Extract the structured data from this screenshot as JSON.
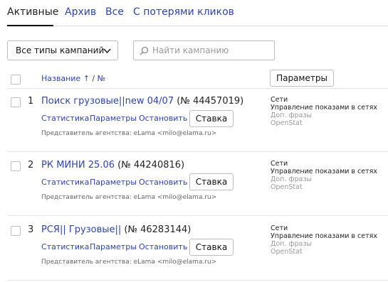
{
  "tabs": [
    "Активные",
    "Архив",
    "Все",
    "С потерями кликов"
  ],
  "filters": {
    "type_dropdown": "Все типы кампаний",
    "search_placeholder": "Найти кампанию"
  },
  "table_header": {
    "name": "Название",
    "sort_arrow": "↑",
    "sep": " / ",
    "num": "№"
  },
  "params_button": "Параметры",
  "actions": {
    "stats": "Статистика",
    "params": "Параметры",
    "stop": "Остановить",
    "bid": "Ставка"
  },
  "campaigns": [
    {
      "index": "1",
      "name": "Поиск грузовые||new 04/07",
      "id": " (№ 44457019)",
      "representative": "Представитель агентства:  eLama <milo@elama.ru>",
      "params": [
        "Сети",
        "Управление показами в сетях",
        "Доп. фразы",
        "OpenStat"
      ]
    },
    {
      "index": "2",
      "name": "РК МИНИ 25.06",
      "id": " (№ 44240816)",
      "representative": "Представитель агентства:  eLama <milo@elama.ru>",
      "params": [
        "Сети",
        "Управление показами в сетях",
        "Доп. фразы",
        "OpenStat"
      ]
    },
    {
      "index": "3",
      "name": "РСЯ|| Грузовые||",
      "id": " (№ 46283144)",
      "representative": "Представитель агентства:  eLama <milo@elama.ru>",
      "params": [
        "Сети",
        "Управление показами в сетях",
        "Доп. фразы",
        "OpenStat"
      ]
    }
  ]
}
